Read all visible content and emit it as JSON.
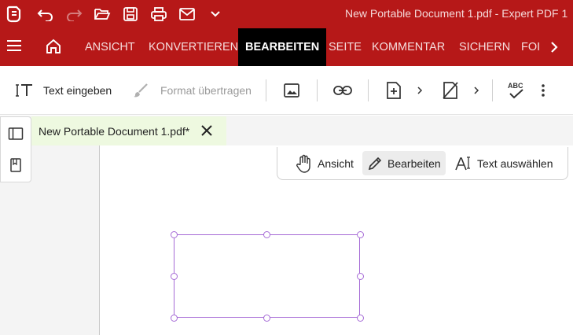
{
  "window": {
    "title": "New Portable Document 1.pdf  -  Expert PDF 1"
  },
  "quick_access": [
    "app-logo-icon",
    "undo-icon",
    "redo-icon",
    "open-folder-icon",
    "save-icon",
    "print-icon",
    "mail-icon",
    "chevron-down-icon"
  ],
  "ribbon": {
    "tabs": [
      {
        "label": "ANSICHT",
        "active": false
      },
      {
        "label": "KONVERTIEREN",
        "active": false
      },
      {
        "label": "BEARBEITEN",
        "active": true
      },
      {
        "label": "SEITE",
        "active": false
      },
      {
        "label": "KOMMENTAR",
        "active": false
      },
      {
        "label": "SICHERN",
        "active": false
      },
      {
        "label": "FOI",
        "active": false
      }
    ]
  },
  "toolbar": {
    "text_input_label": "Text eingeben",
    "format_transfer_label": "Format übertragen",
    "spell_label": "ABC"
  },
  "document_tab": {
    "label": "New Portable Document 1.pdf*"
  },
  "mode_bar": {
    "view_label": "Ansicht",
    "edit_label": "Bearbeiten",
    "select_text_label": "Text auswählen",
    "active": "Bearbeiten"
  },
  "colors": {
    "brand_red": "#b61818",
    "active_tab_bg": "#000000",
    "doc_tab_bg": "#eef9e0",
    "selection": "#a66bd6"
  }
}
